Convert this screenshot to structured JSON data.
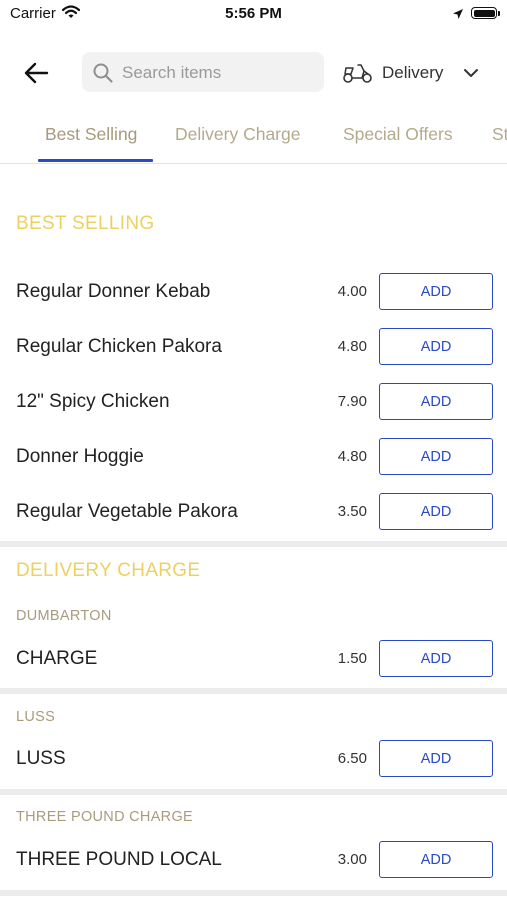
{
  "status_bar": {
    "carrier": "Carrier",
    "time": "5:56 PM"
  },
  "header": {
    "search_placeholder": "Search items",
    "delivery_label": "Delivery"
  },
  "tabs": [
    {
      "label": "Best Selling",
      "active": true
    },
    {
      "label": "Delivery Charge"
    },
    {
      "label": "Special Offers"
    },
    {
      "label": "St"
    }
  ],
  "sections": {
    "best_selling": {
      "title": "BEST SELLING",
      "items": [
        {
          "name": "Regular Donner Kebab",
          "price": "4.00",
          "button": "ADD"
        },
        {
          "name": "Regular Chicken Pakora",
          "price": "4.80",
          "button": "ADD"
        },
        {
          "name": "12\" Spicy Chicken",
          "price": "7.90",
          "button": "ADD"
        },
        {
          "name": "Donner Hoggie",
          "price": "4.80",
          "button": "ADD"
        },
        {
          "name": "Regular Vegetable Pakora",
          "price": "3.50",
          "button": "ADD"
        }
      ]
    },
    "delivery_charge": {
      "title": "DELIVERY CHARGE",
      "groups": [
        {
          "label": "DUMBARTON",
          "item": {
            "name": "CHARGE",
            "price": "1.50",
            "button": "ADD"
          }
        },
        {
          "label": "LUSS",
          "item": {
            "name": "LUSS",
            "price": "6.50",
            "button": "ADD"
          }
        },
        {
          "label": "THREE POUND CHARGE",
          "item": {
            "name": "THREE POUND LOCAL",
            "price": "3.00",
            "button": "ADD"
          }
        }
      ]
    }
  },
  "colors": {
    "accent_blue": "#2a49c4",
    "section_gold": "#ecd060",
    "tab_text": "#b5a98d"
  }
}
